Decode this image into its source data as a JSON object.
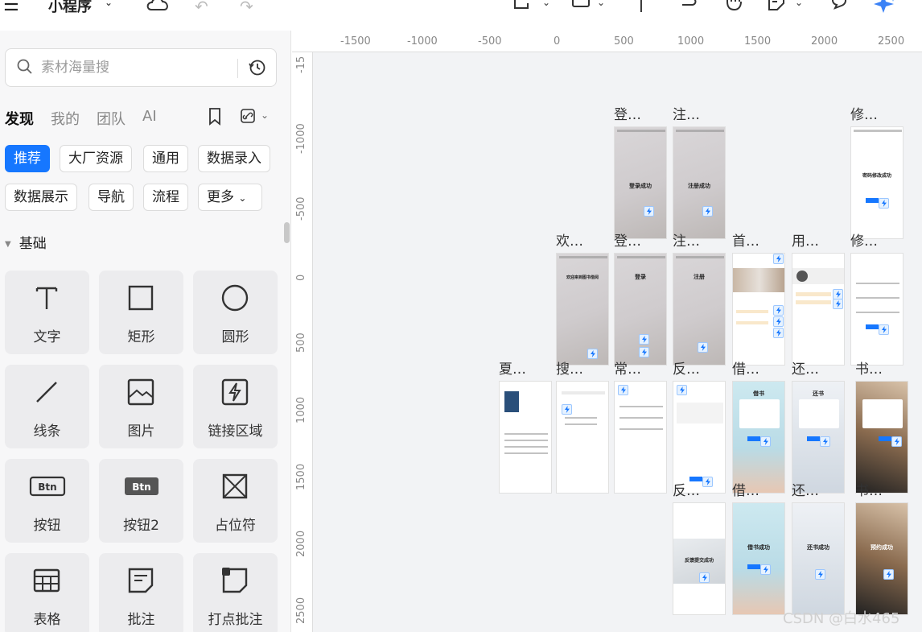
{
  "header": {
    "app_title": "小程序",
    "icons": [
      "menu-icon",
      "cloud-icon",
      "undo-icon",
      "redo-icon",
      "frame-icon",
      "rectangle-icon",
      "text-cursor-icon",
      "connector-icon",
      "hand-icon",
      "note-icon",
      "comment-icon",
      "ai-sparkle-icon"
    ]
  },
  "sidebar": {
    "search_placeholder": "素材海量搜",
    "tabs": [
      "发现",
      "我的",
      "团队",
      "AI"
    ],
    "chips": [
      "推荐",
      "大厂资源",
      "通用",
      "数据录入",
      "数据展示",
      "导航",
      "流程",
      "更多"
    ],
    "section_title": "基础",
    "tiles": [
      "文字",
      "矩形",
      "圆形",
      "线条",
      "图片",
      "链接区域",
      "按钮",
      "按钮2",
      "占位符",
      "表格",
      "批注",
      "打点批注"
    ],
    "btn_icon_text": "Btn"
  },
  "canvas": {
    "ruler_x": [
      "-1500",
      "-1000",
      "-500",
      "0",
      "500",
      "1000",
      "1500",
      "2000",
      "2500"
    ],
    "ruler_y": [
      "-15",
      "-1000",
      "-500",
      "0",
      "500",
      "1000",
      "1500",
      "2000",
      "2500"
    ],
    "frame_labels": [
      "登…",
      "注…",
      "修…",
      "欢…",
      "登…",
      "注…",
      "首…",
      "用…",
      "修…",
      "夏…",
      "搜…",
      "常…",
      "反…",
      "借…",
      "还…",
      "书…",
      "反…",
      "借…",
      "还…",
      "书…"
    ],
    "frame_captions": {
      "login_success": "登录成功",
      "register_success": "注册成功",
      "pwd_success": "密码修改成功",
      "welcome": "欢迎来到图书借阅",
      "login": "登录",
      "register": "注册",
      "borrow": "借书",
      "return": "还书",
      "borrow_success": "借书成功",
      "return_success": "还书成功",
      "feedback_success": "反馈提交成功",
      "reserve_success": "预约成功"
    }
  },
  "watermark": "CSDN @白水465"
}
